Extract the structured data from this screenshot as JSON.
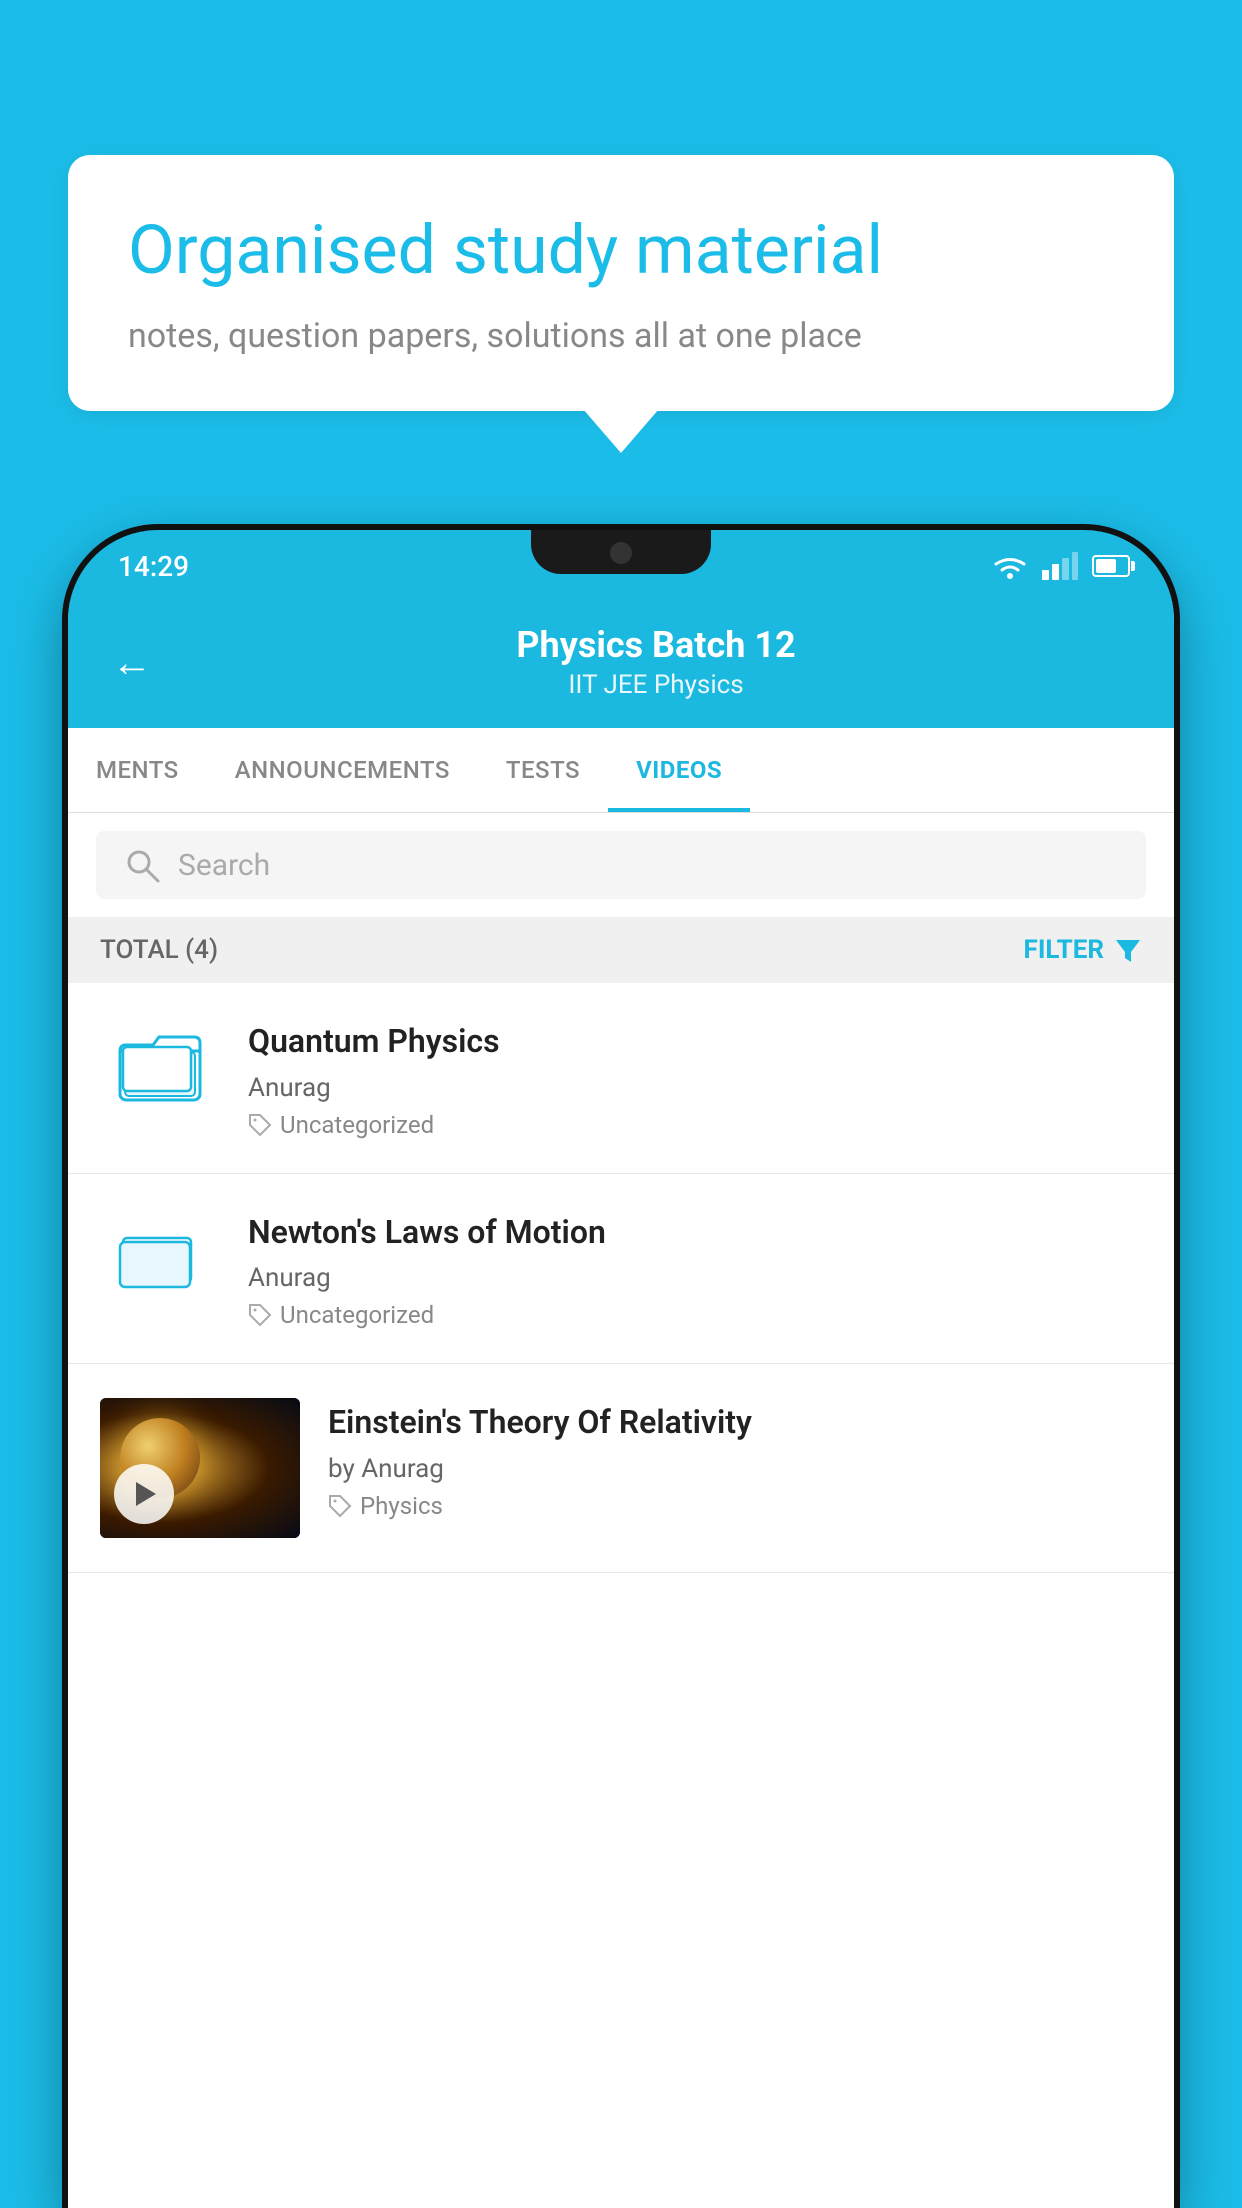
{
  "background_color": "#1bbde8",
  "speech_bubble": {
    "title": "Organised study material",
    "subtitle": "notes, question papers, solutions all at one place"
  },
  "status_bar": {
    "time": "14:29"
  },
  "app_header": {
    "title": "Physics Batch 12",
    "subtitle": "IIT JEE   Physics",
    "back_label": "←"
  },
  "tabs": [
    {
      "label": "MENTS",
      "active": false
    },
    {
      "label": "ANNOUNCEMENTS",
      "active": false
    },
    {
      "label": "TESTS",
      "active": false
    },
    {
      "label": "VIDEOS",
      "active": true
    }
  ],
  "search": {
    "placeholder": "Search"
  },
  "filter_bar": {
    "total_label": "TOTAL (4)",
    "filter_label": "FILTER"
  },
  "videos": [
    {
      "title": "Quantum Physics",
      "author": "Anurag",
      "tag": "Uncategorized",
      "has_thumb": false
    },
    {
      "title": "Newton's Laws of Motion",
      "author": "Anurag",
      "tag": "Uncategorized",
      "has_thumb": false
    },
    {
      "title": "Einstein's Theory Of Relativity",
      "author": "by Anurag",
      "tag": "Physics",
      "has_thumb": true
    }
  ]
}
